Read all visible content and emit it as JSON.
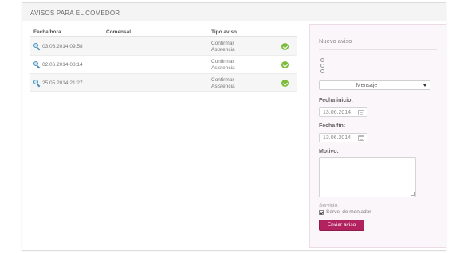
{
  "header": {
    "title": "AVISOS PARA EL COMEDOR"
  },
  "table": {
    "columns": [
      "Fecha/hora",
      "Comensal",
      "Tipo aviso"
    ],
    "rows": [
      {
        "datetime": "03.06.2014 09:58",
        "comensal": "",
        "tipo_line1": "Confirmar",
        "tipo_line2": "Asistencia",
        "status_icon": "check-circle-icon",
        "status_color": "#7dbb3c"
      },
      {
        "datetime": "02.06.2014 08:14",
        "comensal": "",
        "tipo_line1": "Confirmar",
        "tipo_line2": "Asistencia",
        "status_icon": "check-circle-icon",
        "status_color": "#7dbb3c"
      },
      {
        "datetime": "25.05.2014 21:27",
        "comensal": "",
        "tipo_line1": "Confirmar",
        "tipo_line2": "Asistencia",
        "status_icon": "check-circle-icon",
        "status_color": "#7dbb3c"
      }
    ]
  },
  "form": {
    "title": "Nuevo aviso",
    "type_select": {
      "selected": "Mensaje"
    },
    "fecha_inicio": {
      "label": "Fecha inicio:",
      "value": "13.06.2014"
    },
    "fecha_fin": {
      "label": "Fecha fin:",
      "value": "13.06.2014"
    },
    "motivo": {
      "label": "Motivo:",
      "value": ""
    },
    "servicio": {
      "label": "Servicio:",
      "option_label": "Servei de menjador",
      "checked": true
    },
    "submit_label": "Enviar aviso"
  },
  "colors": {
    "accent": "#b1225e",
    "panel_bg": "#fbf6f9",
    "status_ok": "#7dbb3c"
  }
}
